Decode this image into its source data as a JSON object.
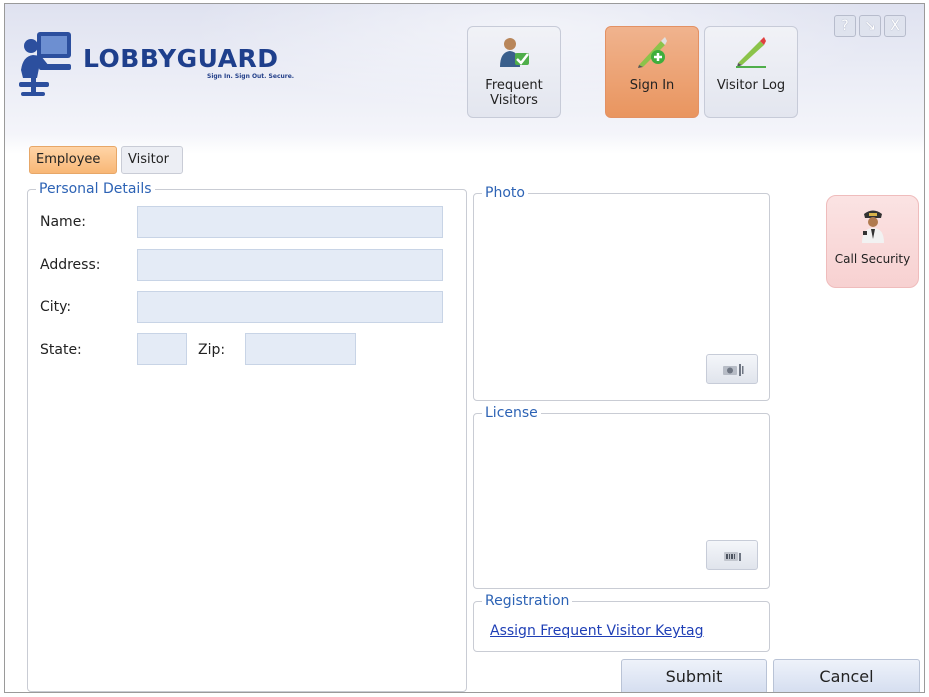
{
  "app": {
    "logo_text": "LOBBYGUARD",
    "logo_tagline": "Sign In. Sign Out. Secure."
  },
  "nav": {
    "frequent_visitors": "Frequent Visitors",
    "sign_in": "Sign In",
    "visitor_log": "Visitor Log"
  },
  "window_controls": {
    "help": "?",
    "minimize": "↘",
    "close": "X"
  },
  "tabs": {
    "employee": "Employee",
    "visitor": "Visitor",
    "selected": "Employee"
  },
  "personal_details": {
    "legend": "Personal Details",
    "name_label": "Name:",
    "address_label": "Address:",
    "city_label": "City:",
    "state_label": "State:",
    "zip_label": "Zip:",
    "name_value": "",
    "address_value": "",
    "city_value": "",
    "state_value": "",
    "zip_value": ""
  },
  "photo": {
    "legend": "Photo"
  },
  "license": {
    "legend": "License"
  },
  "registration": {
    "legend": "Registration",
    "link": "Assign Frequent Visitor Keytag"
  },
  "security": {
    "label": "Call Security"
  },
  "actions": {
    "submit": "Submit",
    "cancel": "Cancel"
  },
  "colors": {
    "accent_orange": "#e9955f",
    "legend_blue": "#2d63b5",
    "link_blue": "#1f3fb6",
    "input_fill": "#e4ebf6",
    "security_pink": "#f7d1d1"
  }
}
